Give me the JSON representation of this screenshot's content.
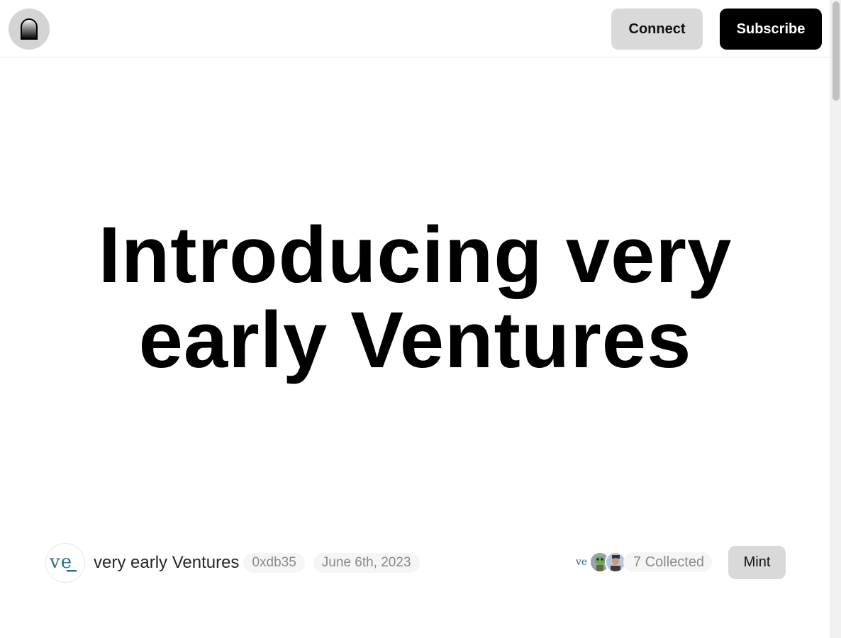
{
  "header": {
    "logo_icon": "arch-logo-icon",
    "connect_label": "Connect",
    "subscribe_label": "Subscribe"
  },
  "article": {
    "title": "Introducing very early Ventures",
    "author": {
      "avatar_text": "ve",
      "name": "very early Ventures",
      "address": "0xdb35"
    },
    "date": "June 6th, 2023",
    "collected": {
      "avatars": [
        "ve-logo-avatar",
        "frog-avatar",
        "person-avatar"
      ],
      "label": "7 Collected"
    },
    "mint_label": "Mint"
  },
  "colors": {
    "brand_teal": "#2a6f8f",
    "button_gray": "#d9d9d9",
    "subscribe_bg": "#000000",
    "pill_bg": "#f5f5f5",
    "muted_text": "#8a8a8a"
  }
}
